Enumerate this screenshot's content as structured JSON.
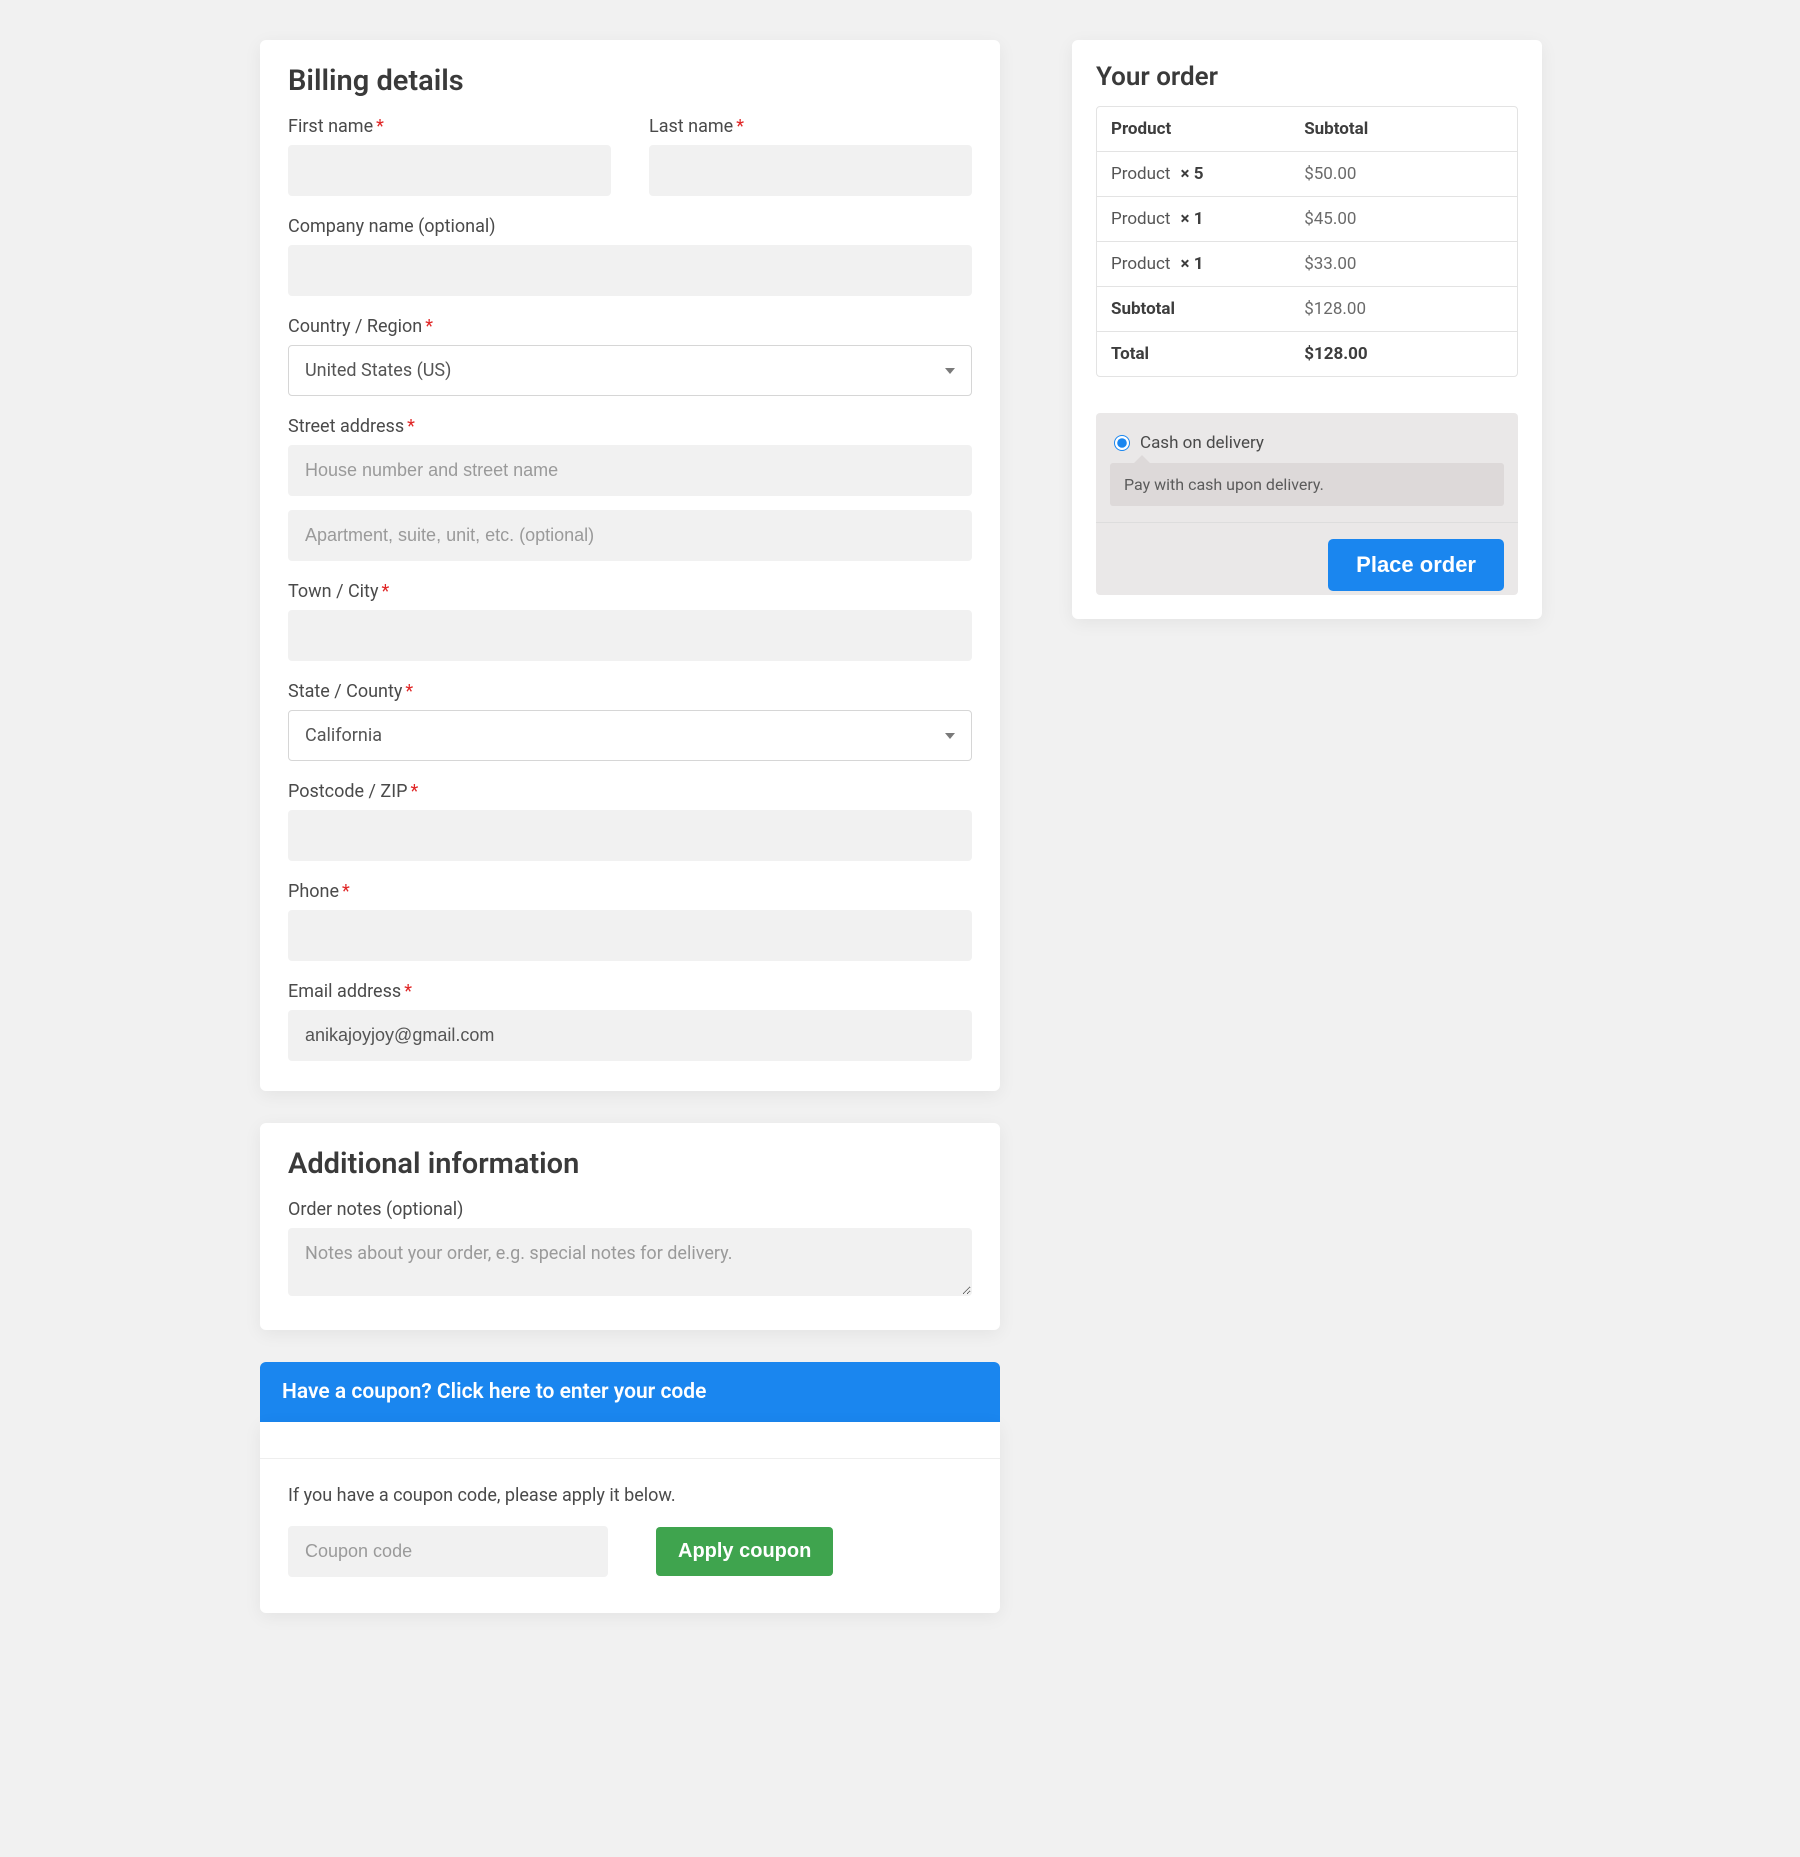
{
  "billing": {
    "heading": "Billing details",
    "first_name": {
      "label": "First name",
      "value": ""
    },
    "last_name": {
      "label": "Last name",
      "value": ""
    },
    "company": {
      "label": "Company name (optional)",
      "value": ""
    },
    "country": {
      "label": "Country / Region",
      "value": "United States (US)"
    },
    "street": {
      "label": "Street address",
      "placeholder1": "House number and street name",
      "placeholder2": "Apartment, suite, unit, etc. (optional)",
      "value1": "",
      "value2": ""
    },
    "city": {
      "label": "Town / City",
      "value": ""
    },
    "state": {
      "label": "State / County",
      "value": "California"
    },
    "postcode": {
      "label": "Postcode / ZIP",
      "value": ""
    },
    "phone": {
      "label": "Phone",
      "value": ""
    },
    "email": {
      "label": "Email address",
      "value": "anikajoyjoy@gmail.com"
    }
  },
  "additional": {
    "heading": "Additional information",
    "notes": {
      "label": "Order notes (optional)",
      "placeholder": "Notes about your order, e.g. special notes for delivery.",
      "value": ""
    }
  },
  "coupon": {
    "bar": "Have a coupon? Click here to enter your code",
    "note": "If you have a coupon code, please apply it below.",
    "placeholder": "Coupon code",
    "button": "Apply coupon"
  },
  "order": {
    "heading": "Your order",
    "columns": {
      "product": "Product",
      "subtotal": "Subtotal"
    },
    "items": [
      {
        "name": "Product",
        "qty": "5",
        "amount": "$50.00"
      },
      {
        "name": "Product",
        "qty": "1",
        "amount": "$45.00"
      },
      {
        "name": "Product",
        "qty": "1",
        "amount": "$33.00"
      }
    ],
    "subtotal_label": "Subtotal",
    "subtotal": "$128.00",
    "total_label": "Total",
    "total": "$128.00"
  },
  "payment": {
    "option_label": "Cash on delivery",
    "option_desc": "Pay with cash upon delivery.",
    "place_order": "Place order"
  },
  "required_marker": "*",
  "qty_prefix": "× "
}
